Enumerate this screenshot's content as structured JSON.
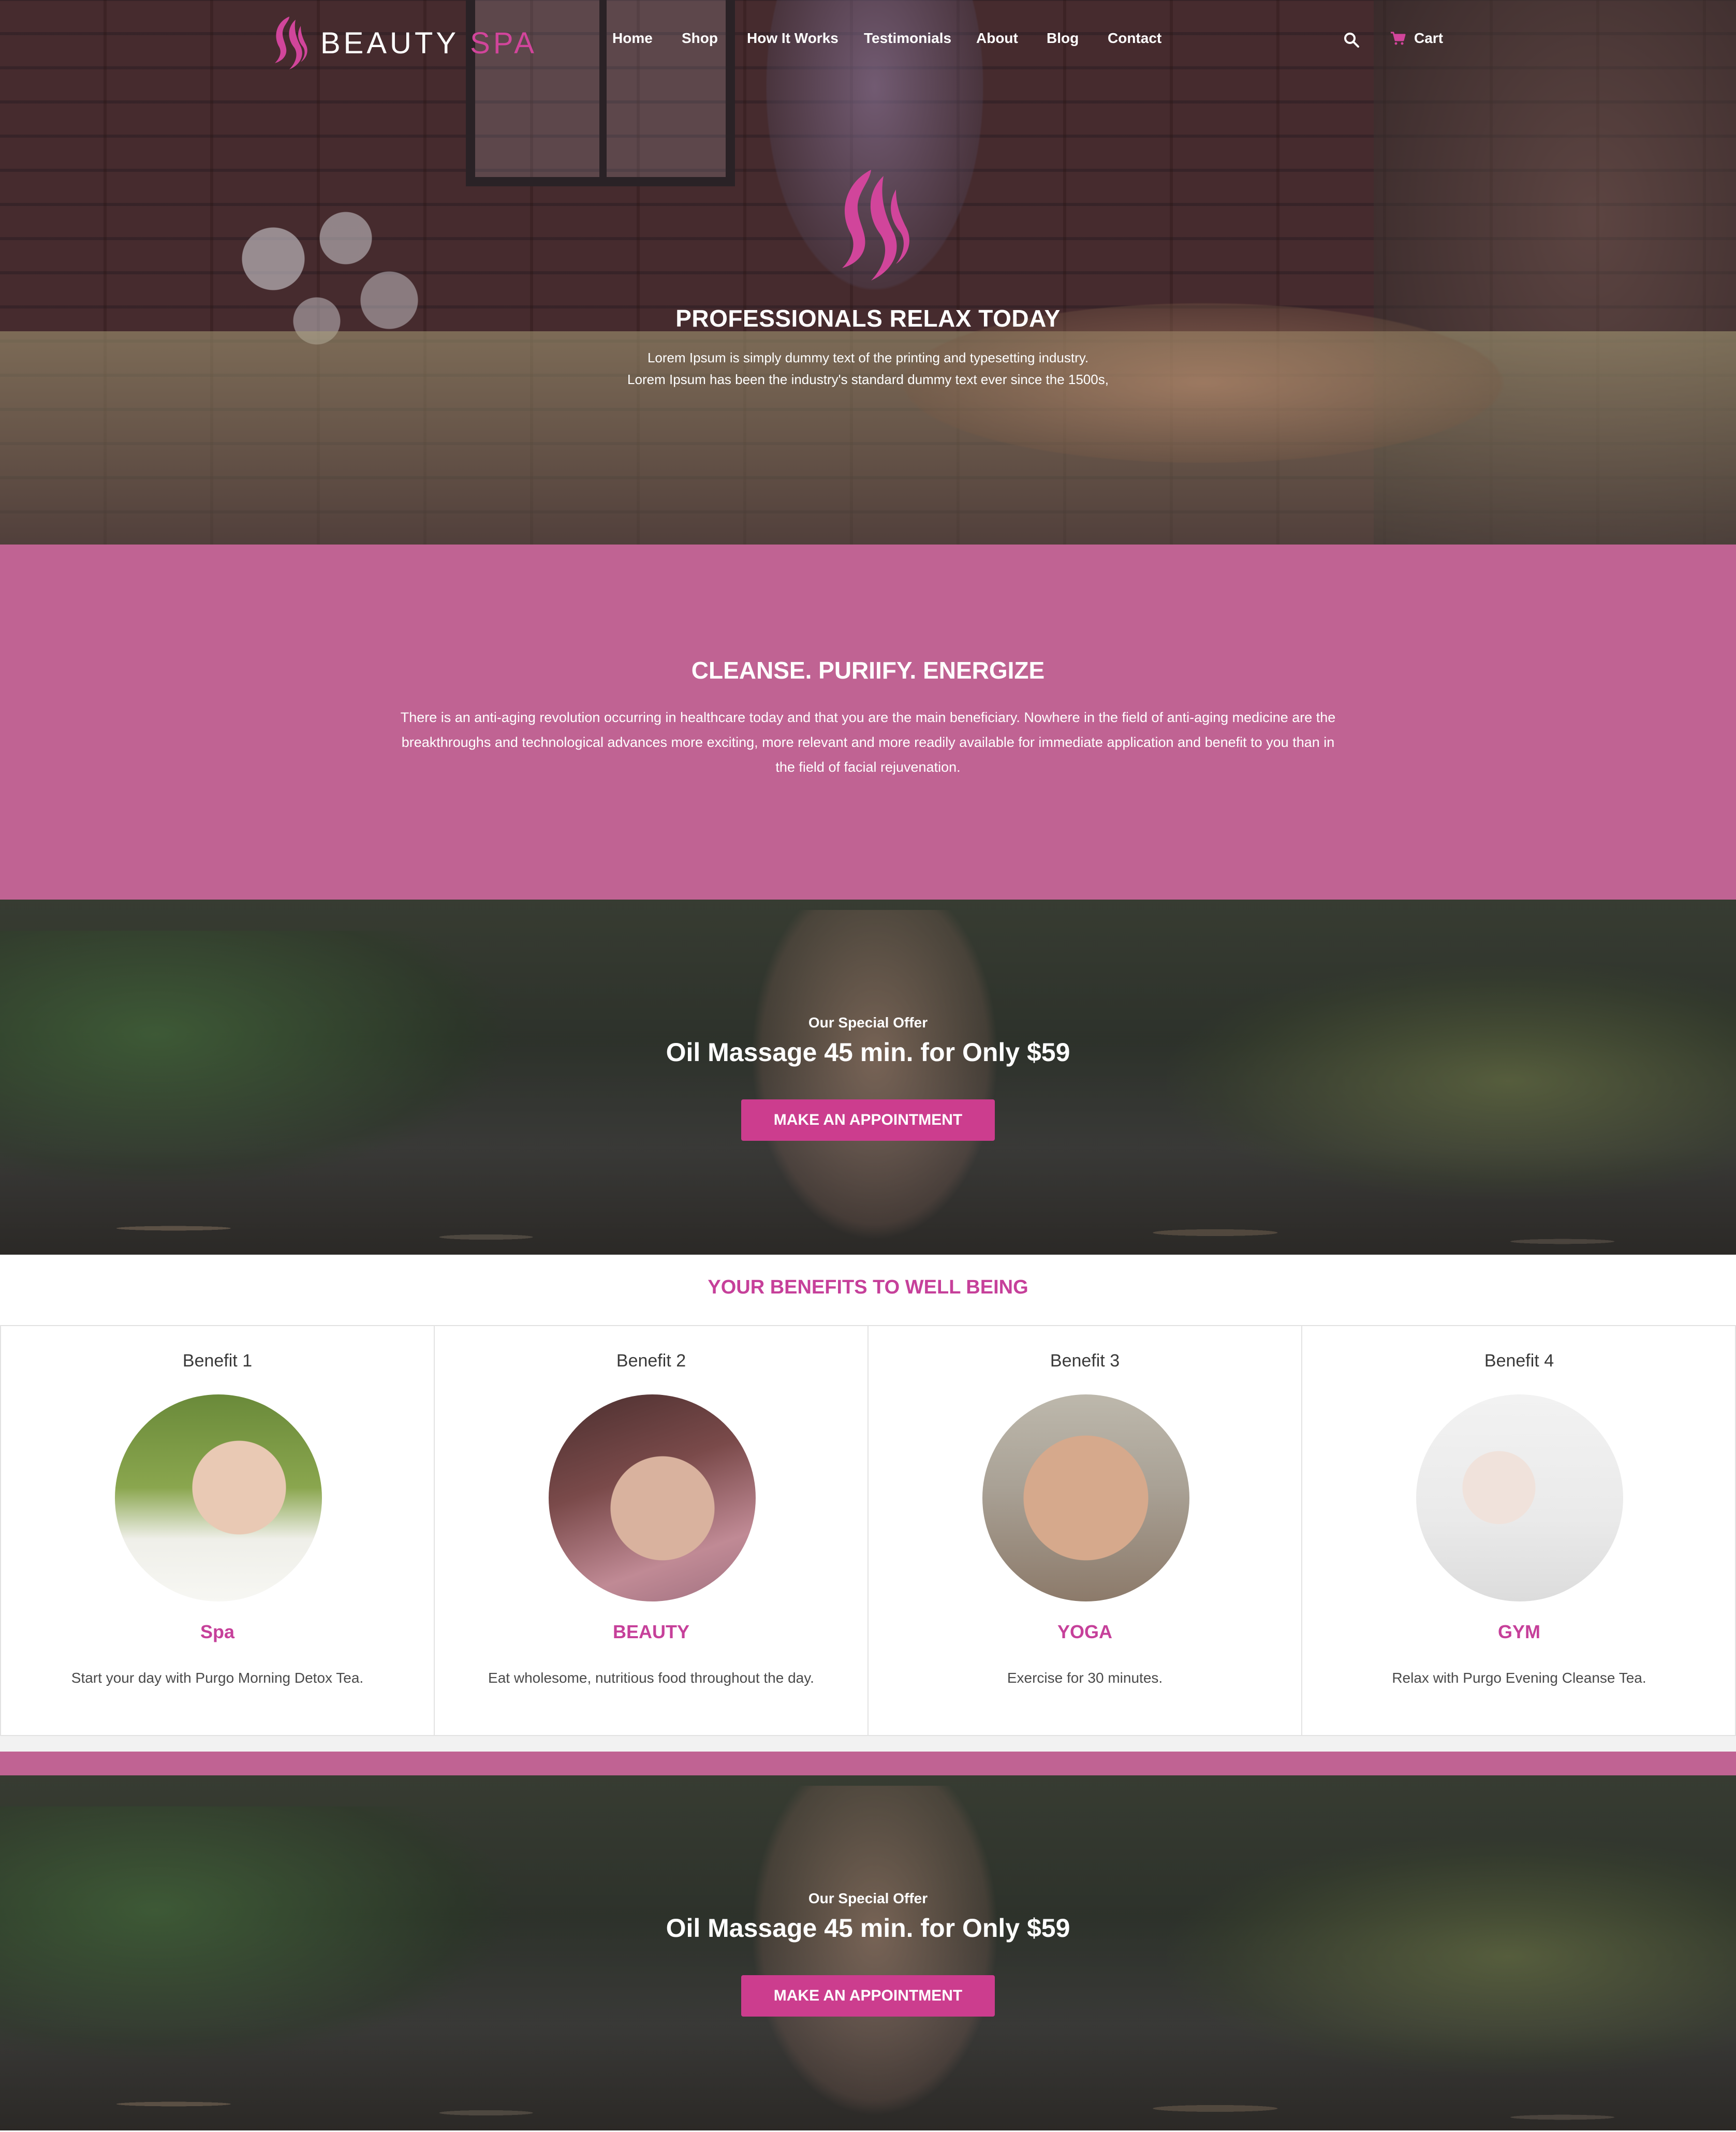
{
  "brand": {
    "name_part1": "BEAUTY",
    "name_part2": "SPA",
    "accent_color": "#d1459b"
  },
  "nav": {
    "items": [
      {
        "label": "Home"
      },
      {
        "label": "Shop"
      },
      {
        "label": "How It Works"
      },
      {
        "label": "Testimonials"
      },
      {
        "label": "About"
      },
      {
        "label": "Blog"
      },
      {
        "label": "Contact"
      }
    ],
    "search_icon": "search-icon",
    "cart_icon": "cart-icon",
    "cart_label": "Cart"
  },
  "hero": {
    "title": "PROFESSIONALS RELAX TODAY",
    "line1": "Lorem Ipsum is simply dummy text of the printing and typesetting industry.",
    "line2": "Lorem Ipsum has been the industry's standard dummy text ever since the 1500s,"
  },
  "intro": {
    "title": "CLEANSE. PURIIFY. ENERGIZE",
    "text": "There is an anti-aging revolution occurring in healthcare today and that you are the main beneficiary. Nowhere in the field of anti-aging medicine are the breakthroughs and technological advances more exciting, more relevant and more readily available for immediate application and benefit to you than in the field of facial rejuvenation.",
    "background_color": "#c06393"
  },
  "offers": [
    {
      "kicker": "Our Special Offer",
      "title": "Oil Massage 45 min. for Only $59",
      "button_label": "MAKE AN APPOINTMENT"
    },
    {
      "kicker": "Our Special Offer",
      "title": "Oil Massage 45 min. for Only $59",
      "button_label": "MAKE AN APPOINTMENT"
    }
  ],
  "benefits": {
    "title": "YOUR BENEFITS TO WELL BEING",
    "title_color": "#c6409a",
    "items": [
      {
        "heading": "Benefit 1",
        "name": "Spa",
        "description": "Start your day with Purgo Morning Detox Tea."
      },
      {
        "heading": "Benefit 2",
        "name": "BEAUTY",
        "description": "Eat wholesome, nutritious food throughout the day."
      },
      {
        "heading": "Benefit 3",
        "name": "YOGA",
        "description": "Exercise for 30 minutes."
      },
      {
        "heading": "Benefit 4",
        "name": "GYM",
        "description": "Relax with Purgo Evening Cleanse Tea."
      }
    ]
  },
  "button_color": "#cc3d8e"
}
